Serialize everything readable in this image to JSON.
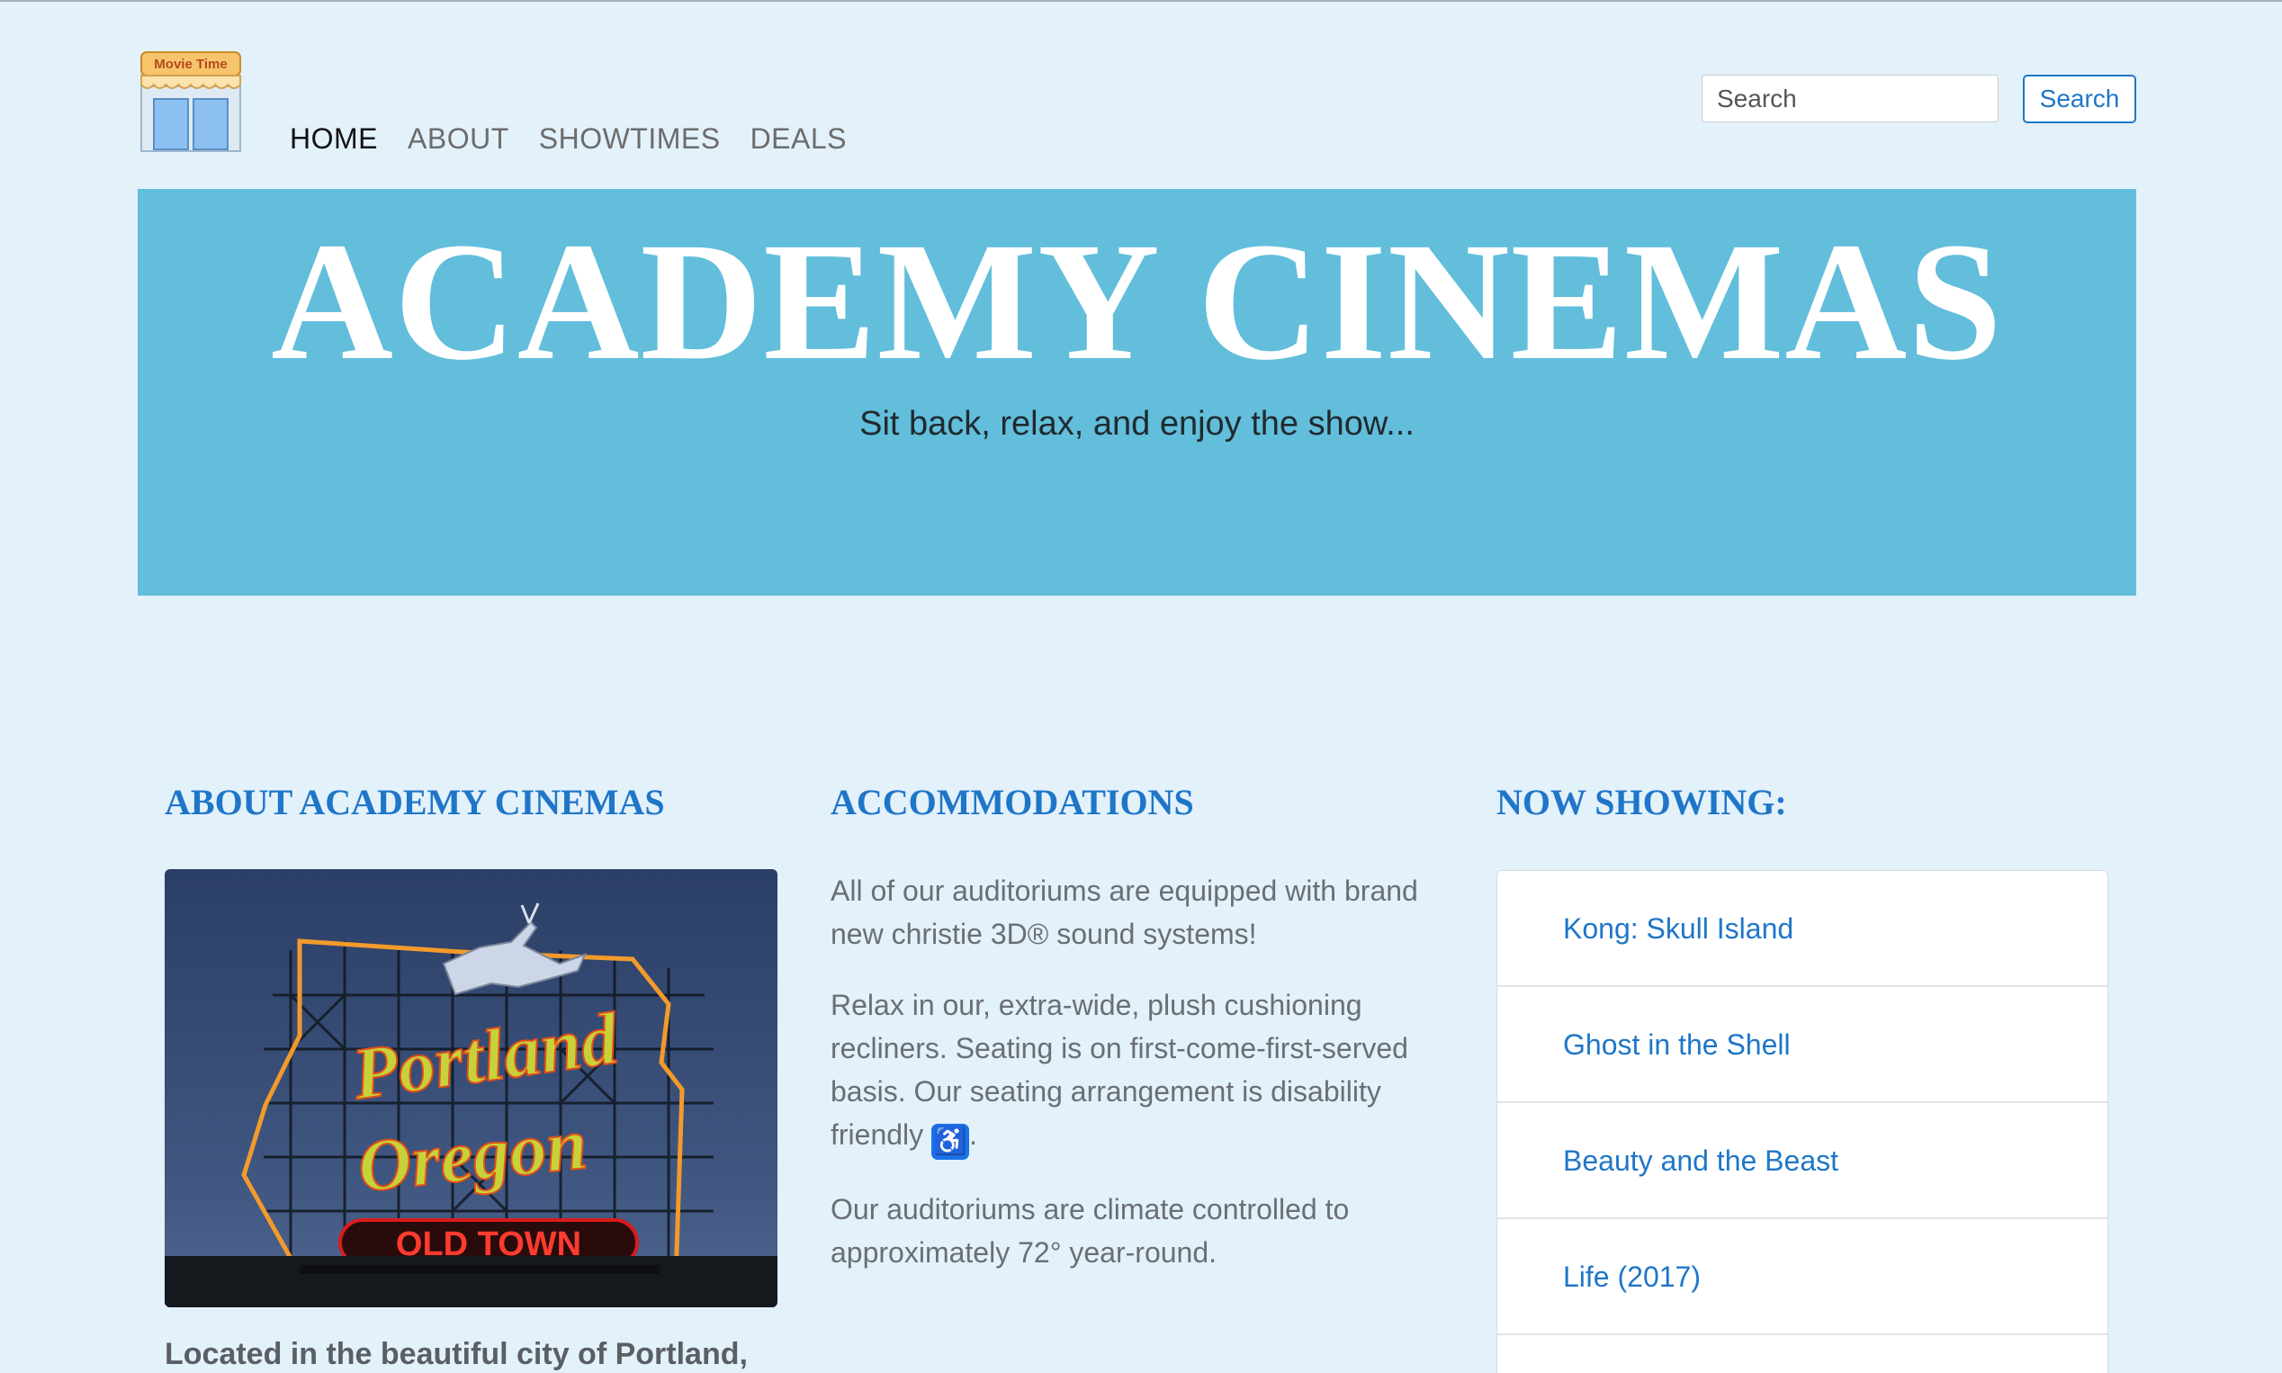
{
  "logo": {
    "sign_text": "Movie Time"
  },
  "nav": {
    "items": [
      {
        "label": "HOME"
      },
      {
        "label": "ABOUT"
      },
      {
        "label": "SHOWTIMES"
      },
      {
        "label": "DEALS"
      }
    ]
  },
  "search": {
    "placeholder": "Search",
    "button_label": "Search"
  },
  "hero": {
    "title": "ACADEMY CINEMAS",
    "tagline": "Sit back, relax, and enjoy the show..."
  },
  "about": {
    "heading": "ABOUT ACADEMY CINEMAS",
    "photo_sign": {
      "line1": "Portland",
      "line2": "Oregon",
      "line3": "OLD TOWN"
    },
    "text": "Located in the beautiful city of Portland,"
  },
  "accommodations": {
    "heading": "ACCOMMODATIONS",
    "p1": "All of our auditoriums are equipped with brand new christie 3D® sound systems!",
    "p2": "Relax in our, extra-wide, plush cushioning recliners. Seating is on first-come-first-served basis. Our seating arrangement is disability friendly",
    "p2_end": ".",
    "p3": "Our auditoriums are climate controlled to approximately 72° year-round."
  },
  "now_showing": {
    "heading": "NOW SHOWING:",
    "movies": [
      {
        "title": "Kong: Skull Island"
      },
      {
        "title": "Ghost in the Shell"
      },
      {
        "title": "Beauty and the Beast"
      },
      {
        "title": "Life (2017)"
      }
    ]
  },
  "colors": {
    "page_bg": "#e3f1fb",
    "hero_bg": "#62bedb",
    "accent": "#1f76c8"
  }
}
